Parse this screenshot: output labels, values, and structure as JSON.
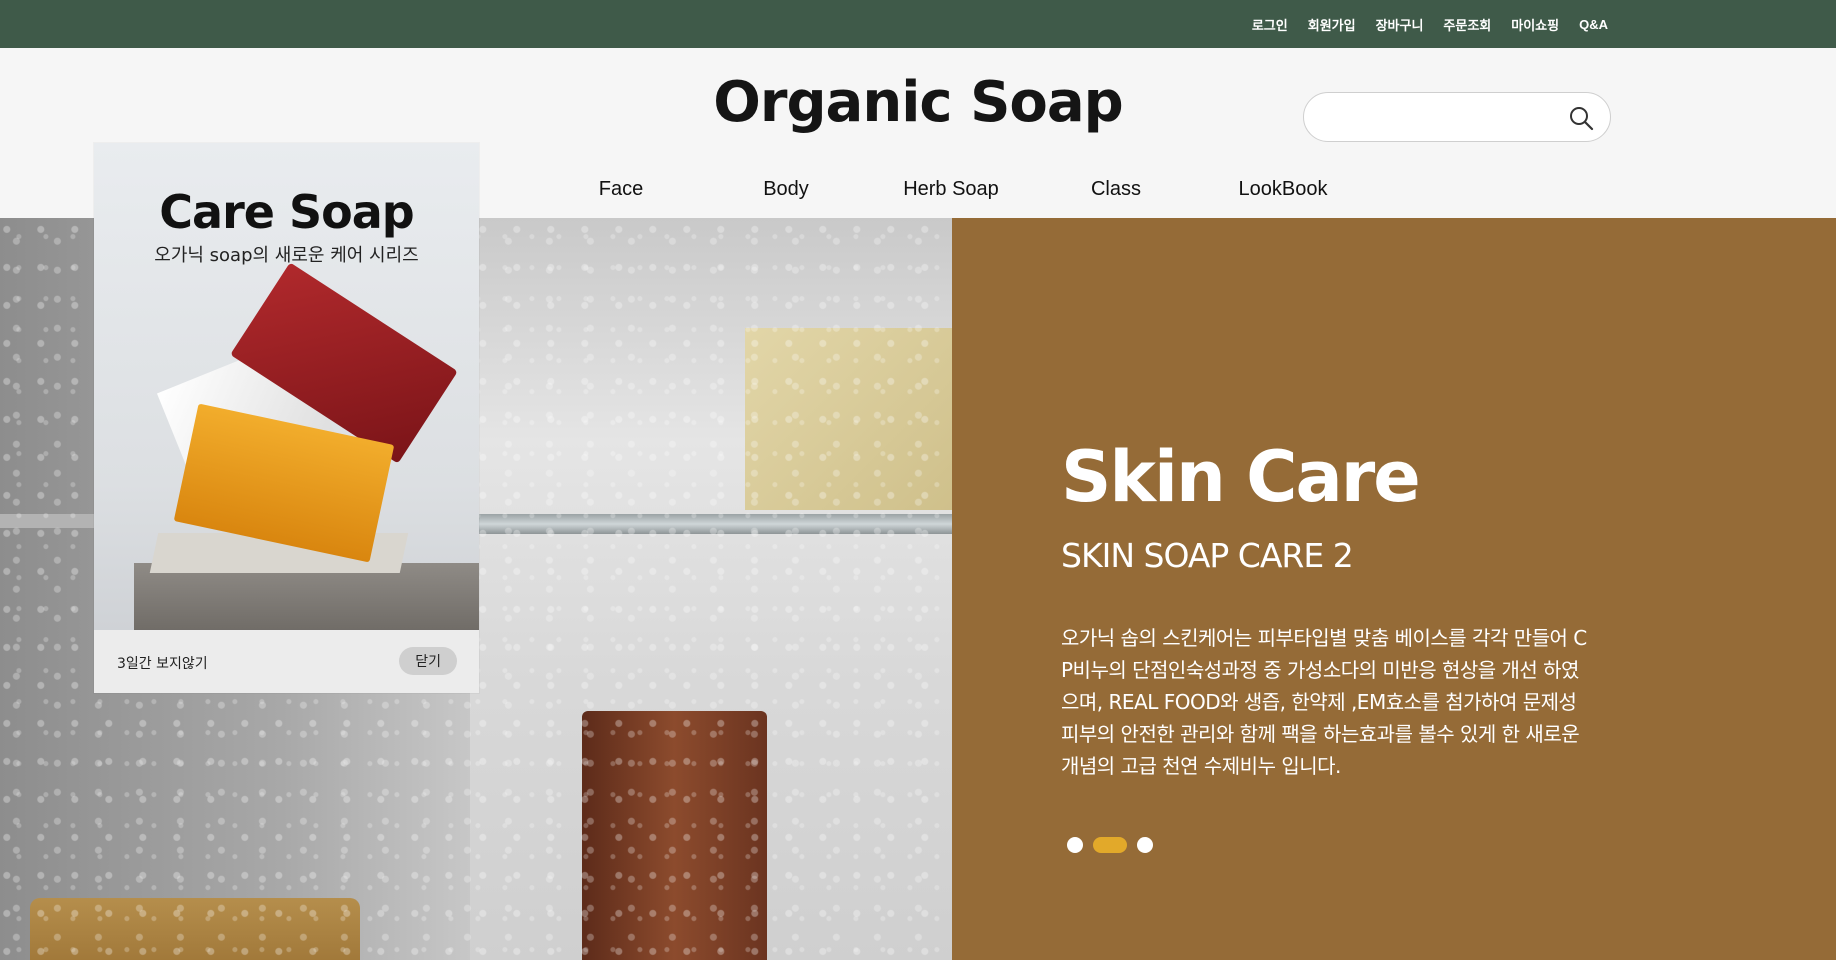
{
  "utility_nav": {
    "links": [
      "로그인",
      "회원가입",
      "장바구니",
      "주문조회",
      "마이쇼핑",
      "Q&A"
    ]
  },
  "header": {
    "logo": "Organic Soap",
    "search": {
      "placeholder": "",
      "value": ""
    }
  },
  "main_nav": {
    "items": [
      "Face",
      "Body",
      "Herb Soap",
      "Class",
      "LookBook"
    ]
  },
  "hero": {
    "title": "Skin Care",
    "subtitle": "SKIN SOAP CARE 2",
    "description": "오가닉 솝의 스킨케어는 피부타입별 맞춤 베이스를 각각 만들어 CP비누의 단점인숙성과정 중 가성소다의 미반응 현상을 개선 하였으며, REAL FOOD와 생즙, 한약제 ,EM효소를 첨가하여 문제성피부의 안전한 관리와 함께 팩을 하는효과를 볼수 있게 한 새로운 개념의 고급 천연 수제비누 입니다.",
    "slides_total": 3,
    "active_slide": 2,
    "colors": {
      "panel": "#956b37",
      "active_dot": "#e2a92a"
    }
  },
  "popup": {
    "title": "Care Soap",
    "subtitle": "오가닉 soap의 새로운 케어 시리즈",
    "dismiss_label": "3일간 보지않기",
    "close_label": "닫기"
  },
  "icons": {
    "search": "search-icon"
  },
  "colors": {
    "topbar": "#3f5a49",
    "page_bg": "#f6f6f6"
  }
}
